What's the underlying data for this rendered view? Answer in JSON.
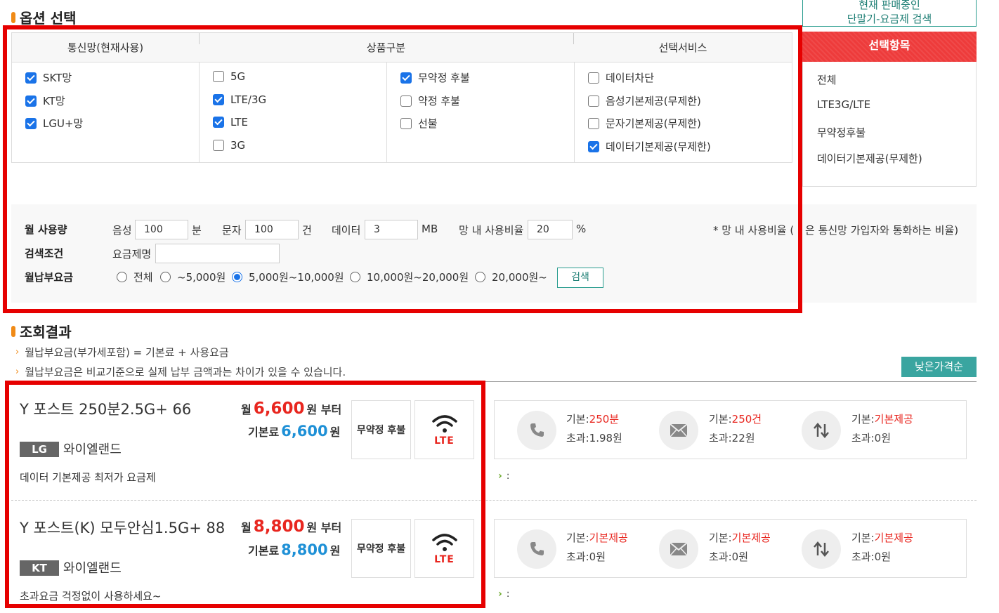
{
  "topbtn": {
    "line1": "현재 판매중인",
    "line2": "단말기-요금제 검색"
  },
  "sections": {
    "options": "옵션 선택",
    "results": "조회결과"
  },
  "table": {
    "headers": [
      "통신망(현재사용)",
      "상품구분",
      "선택서비스"
    ],
    "network": [
      {
        "label": "SKT망",
        "checked": true
      },
      {
        "label": "KT망",
        "checked": true
      },
      {
        "label": "LGU+망",
        "checked": true
      }
    ],
    "product_gen": [
      {
        "label": "5G",
        "checked": false
      },
      {
        "label": "LTE/3G",
        "checked": true
      },
      {
        "label": "LTE",
        "checked": true
      },
      {
        "label": "3G",
        "checked": false
      }
    ],
    "product_type": [
      {
        "label": "무약정 후불",
        "checked": true
      },
      {
        "label": "약정 후불",
        "checked": false
      },
      {
        "label": "선불",
        "checked": false
      }
    ],
    "services": [
      {
        "label": "데이터차단",
        "checked": false
      },
      {
        "label": "음성기본제공(무제한)",
        "checked": false
      },
      {
        "label": "문자기본제공(무제한)",
        "checked": false
      },
      {
        "label": "데이터기본제공(무제한)",
        "checked": true
      }
    ]
  },
  "selected": {
    "title": "선택항목",
    "items": [
      "전체",
      "LTE3G/LTE",
      "무약정후불",
      "데이터기본제공(무제한)"
    ]
  },
  "form": {
    "monthly_label": "월 사용량",
    "voice_label": "음성",
    "voice_value": "100",
    "voice_unit": "분",
    "sms_label": "문자",
    "sms_value": "100",
    "sms_unit": "건",
    "data_label": "데이터",
    "data_value": "3",
    "data_unit": "MB",
    "ratio_label": "망 내 사용비율",
    "ratio_value": "20",
    "ratio_unit": "%",
    "ratio_note_a": "* 망 내 사용비율 (",
    "ratio_note_b": "은 통신망 가입자와 통화하는 비율)",
    "cond_label": "검색조건",
    "planname_label": "요금제명",
    "planname_value": "",
    "fee_label": "월납부요금",
    "fee_options": [
      {
        "label": "전체",
        "selected": false
      },
      {
        "label": "~5,000원",
        "selected": false
      },
      {
        "label": "5,000원~10,000원",
        "selected": true
      },
      {
        "label": "10,000원~20,000원",
        "selected": false
      },
      {
        "label": "20,000원~",
        "selected": false
      }
    ],
    "search_button": "검색"
  },
  "notes": [
    "월납부요금(부가세포함) = 기본료 + 사용요금",
    "월납부요금은 비교기준으로 실제 납부 금액과는 차이가 있을 수 있습니다."
  ],
  "sort_button": "낮은가격순",
  "plans": [
    {
      "name": "Y 포스트 250분2.5G+ 66",
      "month_prefix": "월",
      "month_price": "6,600",
      "month_suffix": "원 부터",
      "base_prefix": "기본료",
      "base_price": "6,600",
      "base_suffix": "원",
      "badge": "LG",
      "carrier": "와이엘랜드",
      "desc": "데이터 기본제공 최저가 요금제",
      "tag": "무약정 후불",
      "network_tag": "LTE",
      "voice_base_label": "기본:",
      "voice_base": "250분",
      "voice_over": "초과:1.98원",
      "sms_base_label": "기본:",
      "sms_base": "250건",
      "sms_over": "초과:22원",
      "data_base_label": "기본:",
      "data_base": "기본제공",
      "data_over": "초과:0원",
      "foot": ":"
    },
    {
      "name": "Y 포스트(K) 모두안심1.5G+ 88",
      "month_prefix": "월",
      "month_price": "8,800",
      "month_suffix": "원 부터",
      "base_prefix": "기본료",
      "base_price": "8,800",
      "base_suffix": "원",
      "badge": "KT",
      "carrier": "와이엘랜드",
      "desc": "초과요금 걱정없이 사용하세요~",
      "tag": "무약정 후불",
      "network_tag": "LTE",
      "voice_base_label": "기본:",
      "voice_base": "기본제공",
      "voice_over": "초과:0원",
      "sms_base_label": "기본:",
      "sms_base": "기본제공",
      "sms_over": "초과:0원",
      "data_base_label": "기본:",
      "data_base": "기본제공",
      "data_over": "초과:0원",
      "foot": ":"
    }
  ],
  "colors": {
    "accent_red": "#e8261f",
    "accent_blue": "#1e90d6",
    "teal": "#3aa5a0",
    "highlight": "#e60000"
  }
}
